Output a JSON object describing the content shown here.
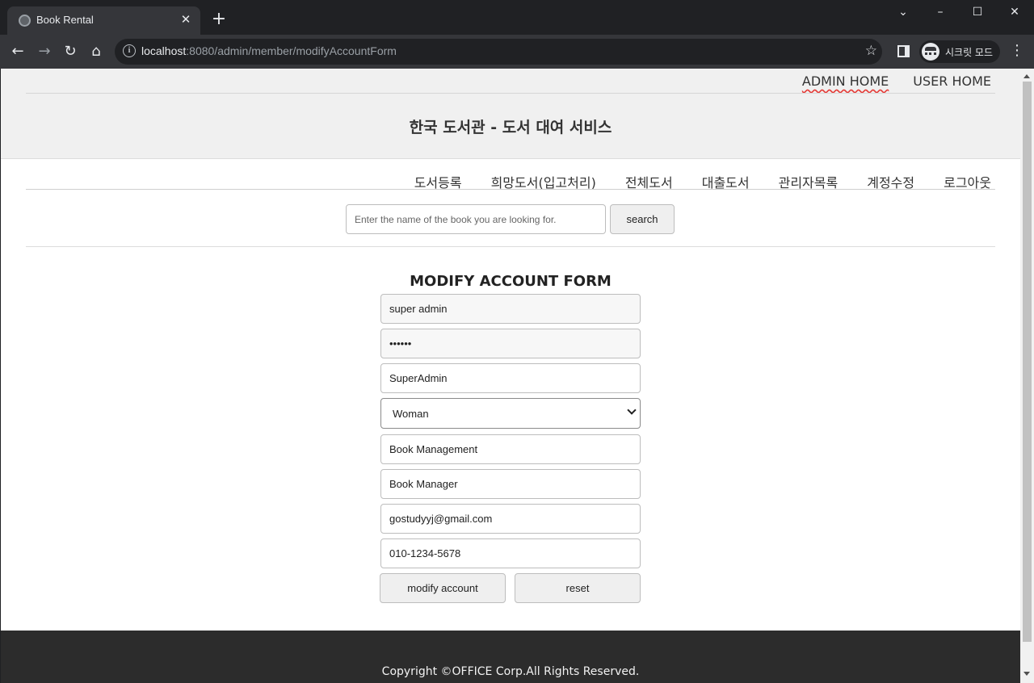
{
  "browser": {
    "tab_title": "Book Rental",
    "url_host": "localhost",
    "url_rest": ":8080/admin/member/modifyAccountForm",
    "incognito_label": "시크릿 모드"
  },
  "header": {
    "links": [
      "ADMIN HOME",
      "USER HOME"
    ],
    "site_title": "한국 도서관 - 도서 대여 서비스"
  },
  "menu": {
    "items": [
      "도서등록",
      "희망도서(입고처리)",
      "전체도서",
      "대출도서",
      "관리자목록",
      "계정수정",
      "로그아웃"
    ]
  },
  "search": {
    "placeholder": "Enter the name of the book you are looking for.",
    "button": "search"
  },
  "form": {
    "title": "MODIFY ACCOUNT FORM",
    "id": "super admin",
    "password": "123456",
    "name": "SuperAdmin",
    "gender": "Woman",
    "department": "Book Management",
    "position": "Book Manager",
    "email": "gostudyyj@gmail.com",
    "phone": "010-1234-5678",
    "submit_label": "modify account",
    "reset_label": "reset"
  },
  "footer": {
    "copyright": "Copyright ©OFFICE Corp.All Rights Reserved."
  }
}
